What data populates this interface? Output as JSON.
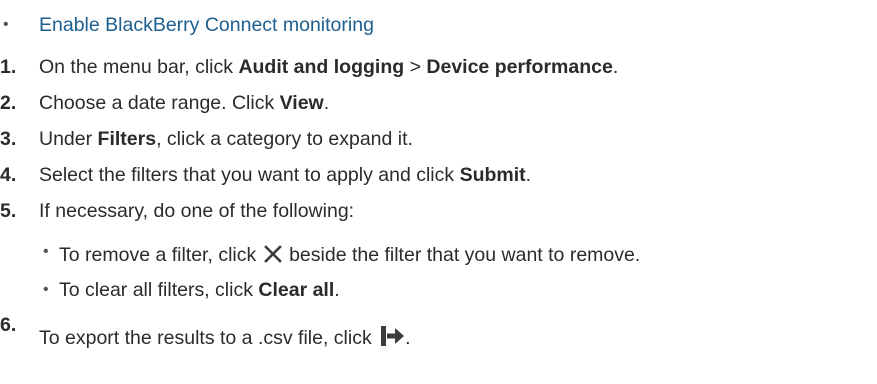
{
  "link": {
    "text": "Enable BlackBerry Connect monitoring"
  },
  "steps": [
    {
      "number": "1.",
      "pre": "On the menu bar, click ",
      "bold1": "Audit and logging",
      "mid": " > ",
      "bold2": "Device performance",
      "post": "."
    },
    {
      "number": "2.",
      "pre": "Choose a date range. Click ",
      "bold1": "View",
      "post": "."
    },
    {
      "number": "3.",
      "pre": "Under ",
      "bold1": "Filters",
      "post": ", click a category to expand it."
    },
    {
      "number": "4.",
      "pre": "Select the filters that you want to apply and click ",
      "bold1": "Submit",
      "post": "."
    },
    {
      "number": "5.",
      "text": "If necessary, do one of the following:"
    },
    {
      "number": "6.",
      "text": "To export the results to a .csv file, click "
    }
  ],
  "substeps": [
    {
      "pre": "To remove a filter, click ",
      "icon": "close-x-icon",
      "post": " beside the filter that you want to remove."
    },
    {
      "pre": "To clear all filters, click ",
      "bold1": "Clear all",
      "post": "."
    }
  ],
  "icons": {
    "remove_filter": "close-x-icon",
    "export": "export-arrow-icon"
  },
  "colors": {
    "link": "#1d5f8f",
    "text": "#2b2b2b",
    "icon": "#3c3c3c"
  }
}
